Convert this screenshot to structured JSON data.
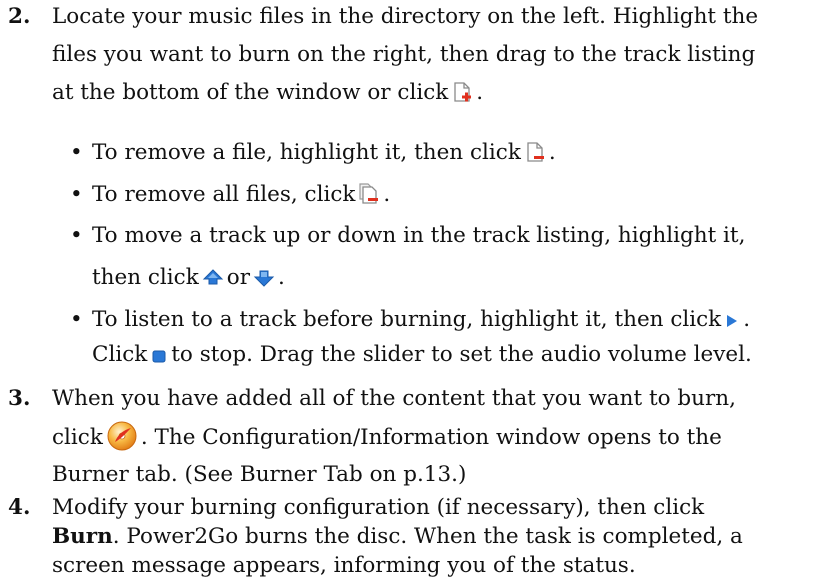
{
  "step2": {
    "number": "2.",
    "line1": "Locate your music files in the directory on the left. Highlight the",
    "line2": "files you want to burn on the right, then drag to the track listing",
    "line3_pre": "at the bottom of the window or click",
    "line3_post": ".",
    "bullets": {
      "remove_file_pre": "To remove a file, highlight it, then click",
      "remove_file_post": ".",
      "remove_all_pre": "To remove all files, click",
      "remove_all_post": ".",
      "move_line1": "To move a track up or down in the track listing, highlight it,",
      "move_pre": "then click",
      "move_mid": "or",
      "move_post": ".",
      "listen_line1_pre": "To listen to a track before burning, highlight it, then click",
      "listen_line1_post": ".",
      "listen_line2_pre": "Click",
      "listen_line2_post": "to stop. Drag the slider to set the audio volume level."
    }
  },
  "step3": {
    "number": "3.",
    "line1": "When you have added all of the content that you want to burn,",
    "line2_pre": "click",
    "line2_post": ". The Configuration/Information window opens to the",
    "line3": "Burner tab. (See Burner Tab on p.13.)"
  },
  "step4": {
    "number": "4.",
    "line1": "Modify your burning configuration (if necessary), then click",
    "line2_bold": "Burn",
    "line2_post": ". Power2Go burns the disc. When the task is completed, a",
    "line3": "screen message appears, informing you of the status."
  },
  "bullet_char": "•",
  "icons": [
    "add-file-icon",
    "remove-file-icon",
    "remove-all-files-icon",
    "move-up-icon",
    "move-down-icon",
    "play-icon",
    "stop-icon",
    "burn-disc-icon"
  ],
  "colors": {
    "text": "#111111",
    "icon_red": "#e0301e",
    "icon_blue": "#2a78d6",
    "burn_orange": "#f29a1f"
  }
}
